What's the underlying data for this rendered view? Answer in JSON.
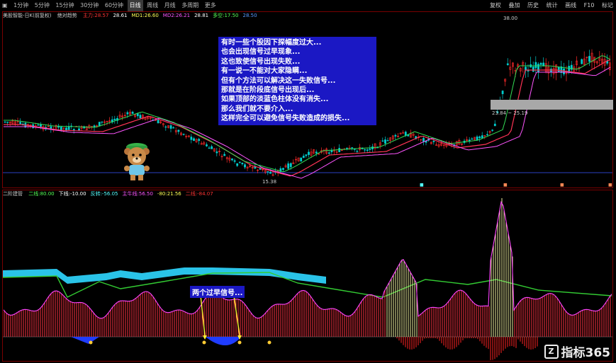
{
  "toolbar": {
    "items": [
      "1分钟",
      "5分钟",
      "15分钟",
      "30分钟",
      "60分钟",
      "日线",
      "周线",
      "月线",
      "多周期",
      "更多"
    ],
    "active": "日线",
    "right": [
      "复权",
      "叠加",
      "历史",
      "统计",
      "画线",
      "F10",
      "标记"
    ]
  },
  "main_legend": {
    "prefix": "美股智能-日K(前复权)",
    "name": "绝对趋势",
    "items": [
      {
        "label": "主力:28.57",
        "color": "#ff3333"
      },
      {
        "label": "28.61",
        "color": "#ffffff"
      },
      {
        "label": "MD1:26.60",
        "color": "#ffff55"
      },
      {
        "label": "MD2:26.21",
        "color": "#ff55ff"
      },
      {
        "label": "28.81",
        "color": "#ffffff"
      },
      {
        "label": "多空:17.50",
        "color": "#55ff55"
      },
      {
        "label": "28.50",
        "color": "#5599ff"
      }
    ]
  },
  "annotation": {
    "lines": [
      "有时一些个股因下探幅度过大...",
      "也会出现信号过早现象...",
      "这也致使信号出现失败...",
      "有一说一不能对大家隐瞒...",
      "但有个方法可以解决这一失败信号...",
      "那就是在阶段底信号出现后...",
      "如果顶部的淡蓝色柱体没有消失...",
      "那么我们就不要介入...",
      "这样完全可以避免信号失败造成的损失..."
    ]
  },
  "price_labels": {
    "low": "15.38",
    "range": "23.84 ~ 25.19",
    "high": "38.00"
  },
  "sub_legend": {
    "name": "二阶建管",
    "items": [
      {
        "label": "二线:80.00",
        "color": "#55ff55"
      },
      {
        "label": "下线:-10.00",
        "color": "#ffffff"
      },
      {
        "label": "反转:-56.05",
        "color": "#55ffff"
      },
      {
        "label": "主牛线:56.50",
        "color": "#ff55ff"
      },
      {
        "label": "-80:21.56",
        "color": "#ffff55"
      },
      {
        "label": "二线:-84.07",
        "color": "#ff3333"
      }
    ]
  },
  "early_label": "两个过早信号...",
  "watermark": {
    "icon": "Z",
    "text": "指标365"
  },
  "colors": {
    "bg": "#000000",
    "up": "#ff2a2a",
    "down": "#00cccc",
    "border": "#7a0000",
    "annot": "#1b18c4"
  }
}
